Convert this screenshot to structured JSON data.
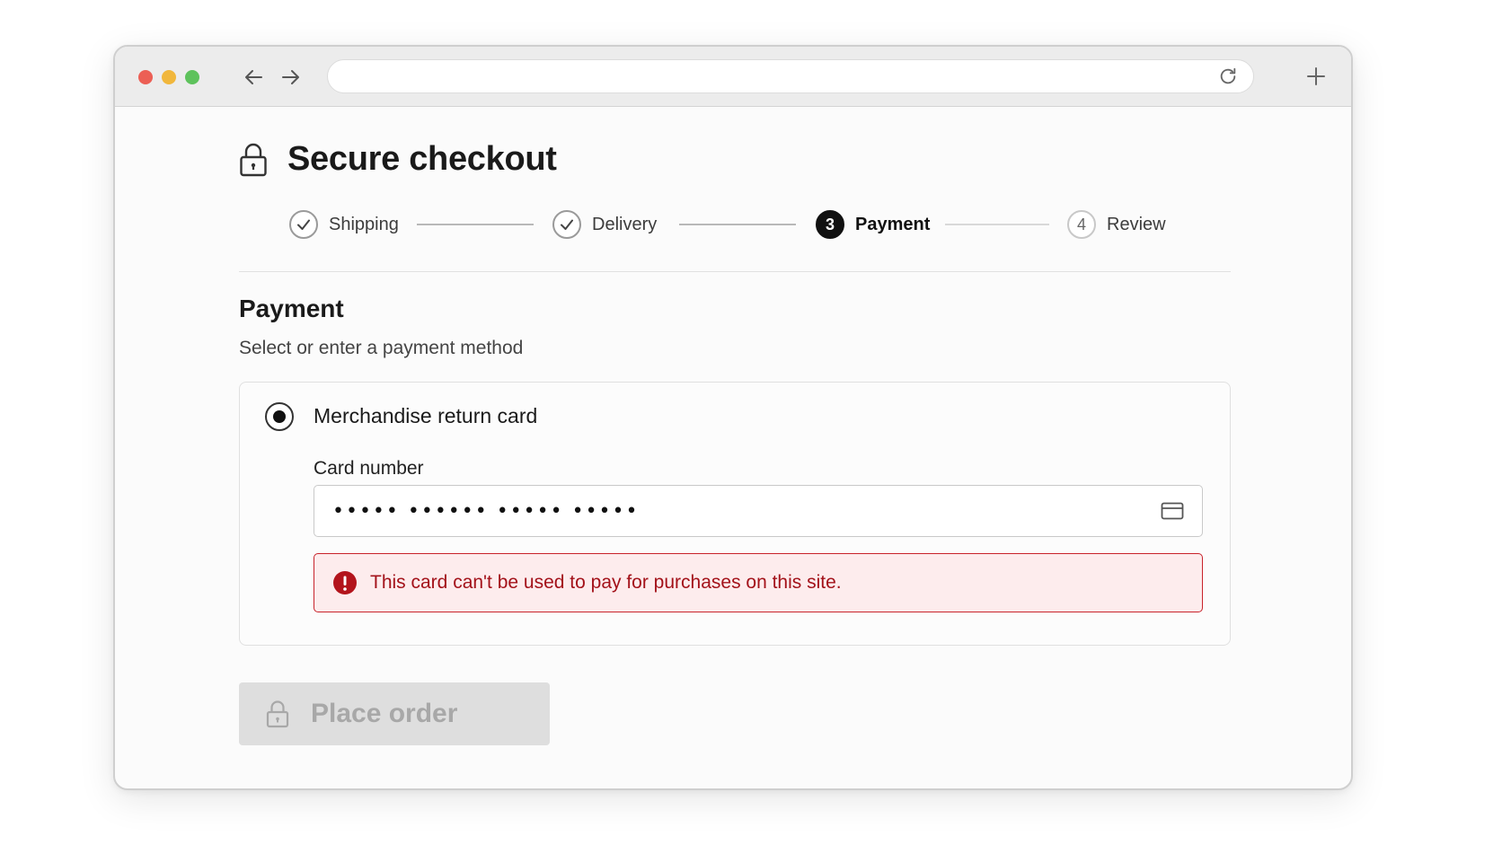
{
  "browser": {
    "url": "",
    "icons": {
      "back": "arrow-left-icon",
      "forward": "arrow-right-icon",
      "reload": "reload-icon",
      "new_tab": "plus-icon"
    }
  },
  "page": {
    "title": "Secure checkout",
    "title_icon": "lock-icon"
  },
  "stepper": {
    "steps": [
      {
        "number": "1",
        "label": "Shipping",
        "state": "complete"
      },
      {
        "number": "2",
        "label": "Delivery",
        "state": "complete"
      },
      {
        "number": "3",
        "label": "Payment",
        "state": "active"
      },
      {
        "number": "4",
        "label": "Review",
        "state": "pending"
      }
    ]
  },
  "payment": {
    "heading": "Payment",
    "subheading": "Select or enter a payment method",
    "method": {
      "label": "Merchandise return card",
      "selected": true
    },
    "card_number": {
      "label": "Card number",
      "value": "••••• •••••• ••••• •••••",
      "icon": "credit-card-icon"
    },
    "error": {
      "message": "This card can't be used to pay for purchases on this site.",
      "icon": "error-icon",
      "color": "#c8232b"
    }
  },
  "actions": {
    "place_order": {
      "label": "Place order",
      "icon": "lock-icon",
      "disabled": true
    }
  }
}
